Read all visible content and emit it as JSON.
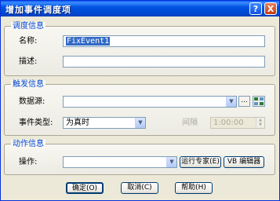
{
  "window": {
    "title": "增加事件调度项",
    "help_glyph": "?",
    "close_glyph": "X"
  },
  "schedule_group": {
    "title": "调度信息",
    "name_label": "名称:",
    "name_value": "FixEvent1",
    "desc_label": "描述:",
    "desc_value": ""
  },
  "trigger_group": {
    "title": "触发信息",
    "datasource_label": "数据源:",
    "datasource_value": "",
    "browse_label": "...",
    "event_type_label": "事件类型:",
    "event_type_value": "为真时",
    "interval_label": "间隔",
    "interval_value": "1:00:00"
  },
  "action_group": {
    "title": "动作信息",
    "operation_label": "操作:",
    "operation_value": "",
    "expert_button": "运行专家(E)",
    "vb_editor_button": "VB 编辑器"
  },
  "footer": {
    "ok": "确定(O)",
    "cancel": "取消(C)",
    "help": "帮助(H)"
  },
  "icons": {
    "dropdown_arrow": "▼",
    "spin_up": "▲",
    "spin_down": "▼"
  }
}
